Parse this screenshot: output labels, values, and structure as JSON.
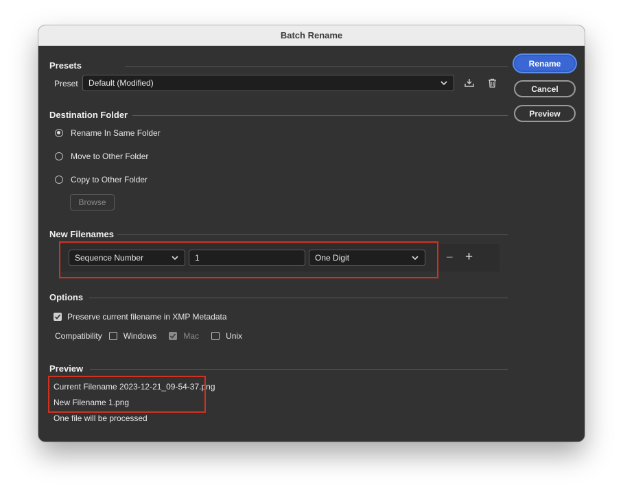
{
  "window": {
    "title": "Batch Rename"
  },
  "buttons": {
    "rename": "Rename",
    "cancel": "Cancel",
    "preview": "Preview"
  },
  "presets": {
    "section_title": "Presets",
    "preset_label": "Preset",
    "preset_value": "Default (Modified)",
    "save_icon": "save-preset-icon",
    "delete_icon": "trash-icon"
  },
  "destination": {
    "section_title": "Destination Folder",
    "options": [
      "Rename In Same Folder",
      "Move to Other Folder",
      "Copy to Other Folder"
    ],
    "selected": "Rename In Same Folder",
    "browse_label": "Browse"
  },
  "new_filenames": {
    "section_title": "New Filenames",
    "type_value": "Sequence Number",
    "number_value": "1",
    "digits_value": "One Digit",
    "remove_label": "−",
    "add_label": "+"
  },
  "options": {
    "section_title": "Options",
    "preserve_label": "Preserve current filename in XMP Metadata",
    "preserve_checked": true,
    "compat_label": "Compatibility",
    "compat_windows": "Windows",
    "compat_mac": "Mac",
    "compat_unix": "Unix"
  },
  "preview": {
    "section_title": "Preview",
    "current_label": "Current Filename",
    "current_value": "2023-12-21_09-54-37.png",
    "new_label": "New Filename",
    "new_value": "1.png",
    "summary": "One file will be processed"
  },
  "colors": {
    "accent": "#3a67d4",
    "highlight_border": "#d1311f",
    "dialog_bg": "#323232"
  }
}
